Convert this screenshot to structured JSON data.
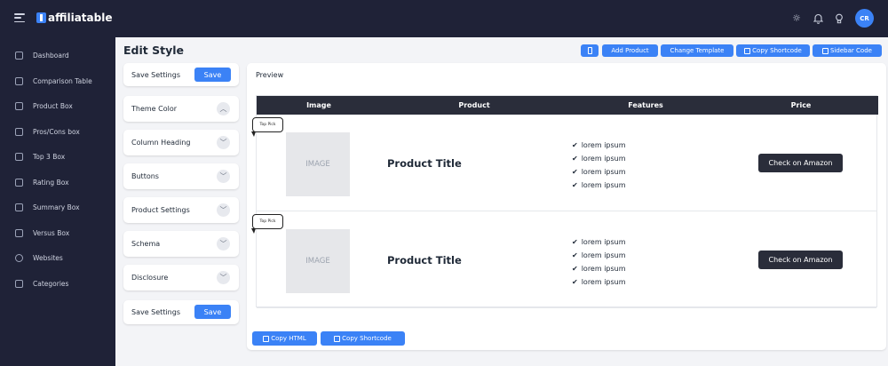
{
  "app": {
    "name": "affiliatable",
    "avatar_initials": "CR"
  },
  "topbar": {
    "icons": [
      "menu-icon",
      "sun-icon",
      "bell-icon",
      "bulb-icon"
    ]
  },
  "sidebar": {
    "items": [
      {
        "label": "Dashboard",
        "icon": "home-icon"
      },
      {
        "label": "Comparison Table",
        "icon": "table-icon"
      },
      {
        "label": "Product Box",
        "icon": "box-icon"
      },
      {
        "label": "Pros/Cons box",
        "icon": "list-icon"
      },
      {
        "label": "Top 3 Box",
        "icon": "sliders-icon"
      },
      {
        "label": "Rating Box",
        "icon": "star-icon"
      },
      {
        "label": "Summary Box",
        "icon": "summary-icon"
      },
      {
        "label": "Versus Box",
        "icon": "versus-icon"
      },
      {
        "label": "Websites",
        "icon": "globe-icon"
      },
      {
        "label": "Categories",
        "icon": "folder-icon"
      }
    ]
  },
  "header": {
    "title": "Edit Style",
    "buttons": {
      "add_product": "Add Product",
      "change_template": "Change Template",
      "copy_shortcode": "Copy Shortcode",
      "sidebar_code": "Sidebar Code"
    }
  },
  "settings": {
    "save_label": "Save Settings",
    "save_button": "Save",
    "sections": [
      "Theme Color",
      "Column Heading",
      "Buttons",
      "Product Settings",
      "Schema",
      "Disclosure"
    ]
  },
  "preview": {
    "label": "Preview",
    "headers": [
      "Image",
      "Product",
      "Features",
      "Price"
    ],
    "rows": [
      {
        "badge": "Top Pick",
        "image": "IMAGE",
        "title": "Product Title",
        "features": [
          "lorem ipsum",
          "lorem ipsum",
          "lorem ipsum",
          "lorem ipsum"
        ],
        "button": "Check on Amazon"
      },
      {
        "badge": "Top Pick",
        "image": "IMAGE",
        "title": "Product Title",
        "features": [
          "lorem ipsum",
          "lorem ipsum",
          "lorem ipsum",
          "lorem ipsum"
        ],
        "button": "Check on Amazon"
      }
    ],
    "copy_html": "Copy HTML",
    "copy_shortcode": "Copy Shortcode"
  },
  "colors": {
    "primary": "#3b82f6",
    "dark": "#1f2237",
    "table_header": "#2a2d3a"
  }
}
